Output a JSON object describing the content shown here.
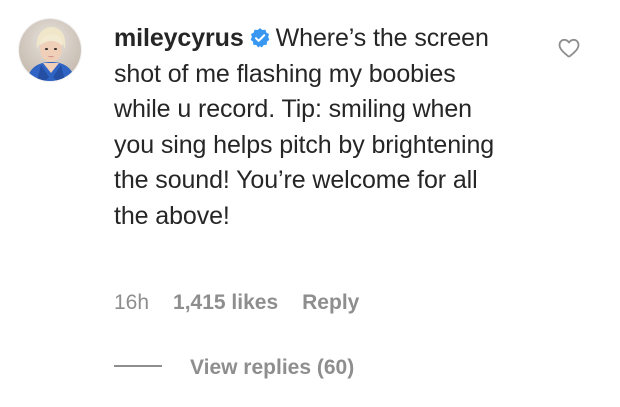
{
  "comment": {
    "username": "mileycyrus",
    "text": "Where’s the screen shot of me flashing my boobies while u record. Tip: smiling when you sing helps pitch by brightening the sound! You’re welcome for all the above!",
    "time": "16h",
    "likes": "1,415 likes",
    "reply_label": "Reply",
    "view_replies_label": "View replies (60)",
    "verified": true,
    "icons": {
      "avatar": "avatar",
      "verified": "verified-badge-icon",
      "like": "heart-icon"
    }
  },
  "colors": {
    "text": "#262626",
    "muted": "#8e8e8e",
    "verified_blue": "#3897f0",
    "background": "#ffffff"
  }
}
